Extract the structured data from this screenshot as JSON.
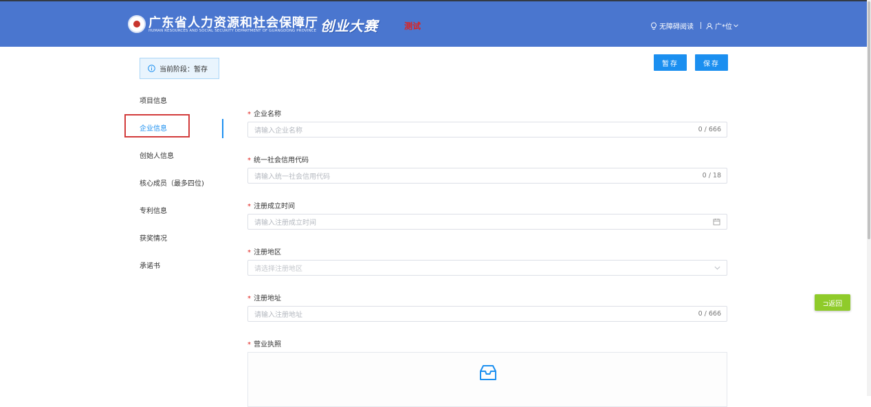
{
  "header": {
    "org_name_cn": "广东省人力资源和社会保障厅",
    "org_name_en": "HUMAN RESOURCES AND SOCIAL SECURITY DEPARTMENT OF GUANGDONG PROVINCE",
    "contest_title": "创业大赛",
    "test_tag": "测试",
    "accessibility": "无障碍阅读",
    "user_name": "广*位",
    "colors": {
      "bar": "#4a76cf",
      "test_tag": "#e0221d"
    }
  },
  "stage": {
    "text": "当前阶段：暂存"
  },
  "toolbar": {
    "draft_label": "暂存",
    "save_label": "保存"
  },
  "nav": {
    "items": [
      {
        "label": "项目信息"
      },
      {
        "label": "企业信息"
      },
      {
        "label": "创始人信息"
      },
      {
        "label": "核心成员（最多四位)"
      },
      {
        "label": "专利信息"
      },
      {
        "label": "获奖情况"
      },
      {
        "label": "承诺书"
      }
    ],
    "active_index": 1
  },
  "form": {
    "company_name": {
      "label": "企业名称",
      "placeholder": "请输入企业名称",
      "counter": "0 / 666"
    },
    "credit_code": {
      "label": "统一社会信用代码",
      "placeholder": "请输入统一社会信用代码",
      "counter": "0 / 18"
    },
    "reg_date": {
      "label": "注册成立时间",
      "placeholder": "请输入注册成立时间"
    },
    "reg_region": {
      "label": "注册地区",
      "placeholder": "请选择注册地区"
    },
    "reg_address": {
      "label": "注册地址",
      "placeholder": "请输入注册地址",
      "counter": "0 / 666"
    },
    "license": {
      "label": "营业执照"
    }
  },
  "float": {
    "back_label": "⊐返回"
  },
  "colors": {
    "primary": "#1b8ff0",
    "back": "#8fcb2a",
    "required": "#e0221d"
  }
}
